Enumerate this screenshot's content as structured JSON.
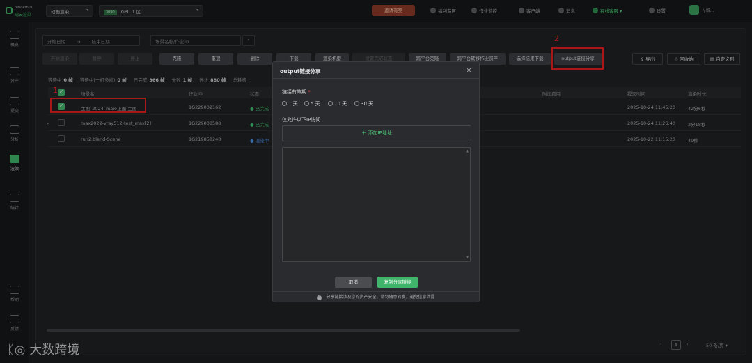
{
  "topbar": {
    "logo_line1": "renderbus",
    "logo_line2": "瑞云渲染",
    "mode_select": "动画渲染",
    "gpu_tag": "3090",
    "gpu_select": "GPU 1 区",
    "invite": "邀请有奖",
    "nav": [
      "福利专区",
      "作业监控",
      "客户端",
      "消息"
    ],
    "online_service": "在线客服",
    "settings": "设置",
    "user": "\\ 维..."
  },
  "sidebar": [
    "概览",
    "资产",
    "提交",
    "分析",
    "渲染",
    "统计",
    "帮助",
    "反馈"
  ],
  "filters": {
    "start_date": "开始日期",
    "arrow": "→",
    "end_date": "结束日期",
    "search_placeholder": "场景名称/作业ID"
  },
  "toolbar": [
    "开始渲染",
    "暂停",
    "停止",
    "克隆",
    "重提",
    "删除",
    "下载",
    "渲染机型",
    "设置完成状态",
    "跨平台克隆",
    "跨平台转移作业资产",
    "选择结果下载",
    "output链接分享"
  ],
  "right_tools": [
    "导出",
    "回收站",
    "自定义列"
  ],
  "stats": [
    {
      "label": "等待中",
      "value": "0 帧"
    },
    {
      "label": "等待中(一机多帧)",
      "value": "0 帧"
    },
    {
      "label": "已完成",
      "value": "366 帧"
    },
    {
      "label": "失败",
      "value": "1 帧"
    },
    {
      "label": "停止",
      "value": "880 帧"
    },
    {
      "label": "总耗费",
      "value": ""
    }
  ],
  "table": {
    "headers": [
      "场景名",
      "作业ID",
      "状态",
      "附加费用",
      "提交时间",
      "渲染时长"
    ],
    "rows": [
      {
        "scene": "主图_2024_max·正面·主图",
        "id": "1G229002162",
        "status": "已完成",
        "status_color": "green",
        "time": "2025-10-24 11:45:20",
        "duration": "42分6秒",
        "checked": true
      },
      {
        "scene": "max2022-vray512-test_max[2]",
        "id": "1G229008580",
        "status": "已完成",
        "status_color": "green",
        "time": "2025-10-24 11:26:40",
        "duration": "2分18秒",
        "checked": false
      },
      {
        "scene": "run2.blend-Scene",
        "id": "1G219858240",
        "status": "渲染中",
        "status_color": "blue",
        "time": "2025-10-22 11:15:20",
        "duration": "49秒",
        "checked": false
      }
    ]
  },
  "modal": {
    "title": "output链接分享",
    "close": "×",
    "validity_label": "链接有效期",
    "required_mark": "*",
    "options": [
      "1 天",
      "5 天",
      "10 天",
      "30 天"
    ],
    "ip_label": "仅允许以下IP访问",
    "add_ip": "添加IP地址",
    "cancel": "取消",
    "copy": "复制分享链接",
    "notice": "分享链接涉及您的资产安全，请勿随意转发，避免信息泄露"
  },
  "annotations": [
    "1",
    "2"
  ],
  "pager": {
    "current": "1",
    "size": "50 条/页"
  },
  "watermark": "大数跨境"
}
